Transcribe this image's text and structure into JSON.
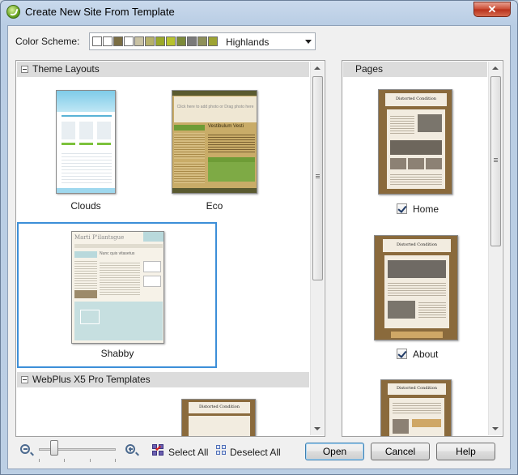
{
  "window": {
    "title": "Create New Site From Template",
    "close_glyph": "✕"
  },
  "color_scheme": {
    "label": "Color Scheme:",
    "selected": "Highlands",
    "swatches": [
      "#ffffff",
      "#ffffff",
      "#7a6d43",
      "#ffffff",
      "#c9c2a4",
      "#b5b06a",
      "#9aa82a",
      "#b7c22e",
      "#7c8a3a",
      "#7a7a7a",
      "#8d8f5a",
      "#9da333"
    ]
  },
  "left_panel": {
    "groups": [
      {
        "label": "Theme Layouts"
      },
      {
        "label": "WebPlus X5 Pro Templates"
      }
    ],
    "themes": [
      {
        "label": "Clouds",
        "thumb_header": "",
        "thumb_body": ""
      },
      {
        "label": "Eco",
        "thumb_header": "Click here to add photo or Drag photo here",
        "thumb_body": "Vestibulum Vesti"
      },
      {
        "label": "Shabby",
        "thumb_header": "Marti P'ilantsgue",
        "thumb_body": "Nunc quis vitasetus"
      }
    ],
    "selected_theme": "Shabby"
  },
  "right_panel": {
    "header": "Pages",
    "pages": [
      {
        "label": "Home",
        "checked": true,
        "thumb_title": "Distorted Condition"
      },
      {
        "label": "About",
        "checked": true,
        "thumb_title": "Distorted Condition"
      },
      {
        "label": "",
        "checked": false,
        "thumb_title": "Distorted Condition"
      }
    ]
  },
  "toolbar": {
    "select_all": "Select All",
    "deselect_all": "Deselect All",
    "open": "Open",
    "cancel": "Cancel",
    "help": "Help"
  },
  "zoom": {
    "level_fraction": 0.2
  },
  "colors": {
    "accent_selection": "#3c8fd8",
    "close_red": "#c94a32",
    "wood": "#8a6a3c"
  }
}
